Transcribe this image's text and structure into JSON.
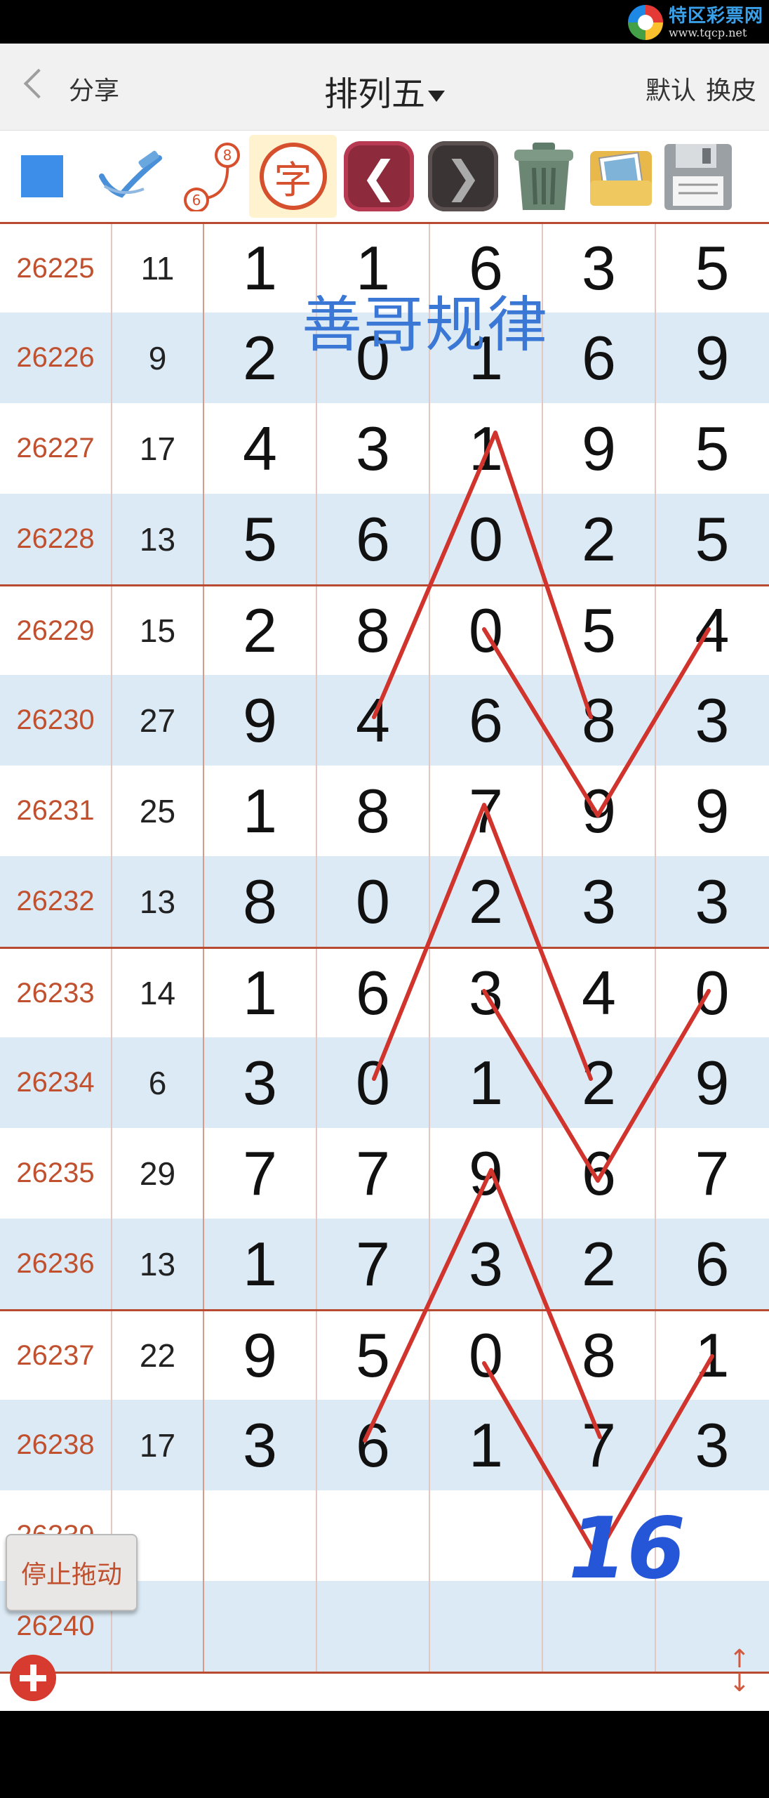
{
  "watermark": {
    "name": "特区彩票网",
    "url": "www.tqcp.net"
  },
  "titlebar": {
    "share_label": "分享",
    "title": "排列五",
    "default_label": "默认",
    "skin_label": "换皮"
  },
  "toolbar": {
    "char_label": "字",
    "number_badge_top": "8",
    "number_badge_bottom": "6",
    "undo_glyph": "❮",
    "redo_glyph": "❯"
  },
  "overlay": {
    "rule_title": "善哥规律",
    "handwritten": "16"
  },
  "rows": [
    {
      "issue": "26225",
      "sum": "11",
      "digits": [
        "1",
        "1",
        "6",
        "3",
        "5"
      ]
    },
    {
      "issue": "26226",
      "sum": "9",
      "digits": [
        "2",
        "0",
        "1",
        "6",
        "9"
      ]
    },
    {
      "issue": "26227",
      "sum": "17",
      "digits": [
        "4",
        "3",
        "1",
        "9",
        "5"
      ]
    },
    {
      "issue": "26228",
      "sum": "13",
      "digits": [
        "5",
        "6",
        "0",
        "2",
        "5"
      ]
    },
    {
      "issue": "26229",
      "sum": "15",
      "digits": [
        "2",
        "8",
        "0",
        "5",
        "4"
      ]
    },
    {
      "issue": "26230",
      "sum": "27",
      "digits": [
        "9",
        "4",
        "6",
        "8",
        "3"
      ]
    },
    {
      "issue": "26231",
      "sum": "25",
      "digits": [
        "1",
        "8",
        "7",
        "9",
        "9"
      ]
    },
    {
      "issue": "26232",
      "sum": "13",
      "digits": [
        "8",
        "0",
        "2",
        "3",
        "3"
      ]
    },
    {
      "issue": "26233",
      "sum": "14",
      "digits": [
        "1",
        "6",
        "3",
        "4",
        "0"
      ]
    },
    {
      "issue": "26234",
      "sum": "6",
      "digits": [
        "3",
        "0",
        "1",
        "2",
        "9"
      ]
    },
    {
      "issue": "26235",
      "sum": "29",
      "digits": [
        "7",
        "7",
        "9",
        "6",
        "7"
      ]
    },
    {
      "issue": "26236",
      "sum": "13",
      "digits": [
        "1",
        "7",
        "3",
        "2",
        "6"
      ]
    },
    {
      "issue": "26237",
      "sum": "22",
      "digits": [
        "9",
        "5",
        "0",
        "8",
        "1"
      ]
    },
    {
      "issue": "26238",
      "sum": "17",
      "digits": [
        "3",
        "6",
        "1",
        "7",
        "3"
      ]
    },
    {
      "issue": "26239",
      "sum": "",
      "digits": [
        "",
        "",
        "",
        "",
        ""
      ]
    },
    {
      "issue": "26240",
      "sum": "",
      "digits": [
        "",
        "",
        "",
        "",
        ""
      ]
    }
  ],
  "float": {
    "stop_drag_label": "停止拖动"
  },
  "colors": {
    "accent_red": "#c0502e",
    "row_alt": "#dceaf5",
    "stroke_red": "#d0342c",
    "hand_blue": "#2656d8"
  }
}
